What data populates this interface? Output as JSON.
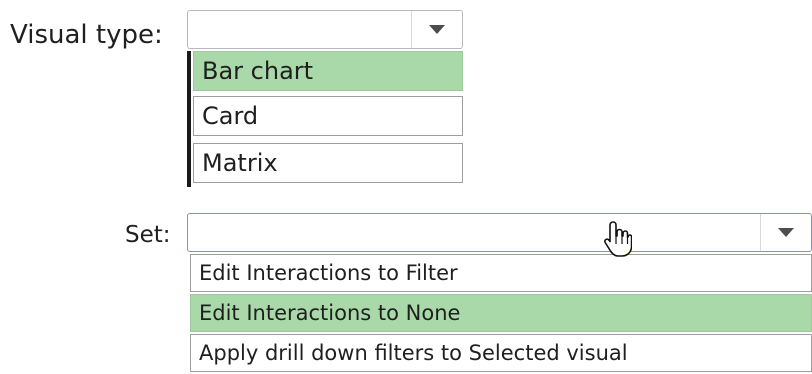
{
  "visual_type": {
    "label": "Visual type:",
    "value": "",
    "options": [
      "Bar chart",
      "Card",
      "Matrix"
    ],
    "selected": "Bar chart"
  },
  "set": {
    "label": "Set:",
    "value": "",
    "options": [
      "Edit Interactions to Filter",
      "Edit Interactions to None",
      "Apply drill down filters to Selected visual"
    ],
    "selected": "Edit Interactions to None"
  },
  "icons": {
    "dropdown_arrow": "chevron-down-icon",
    "cursor": "hand-pointer-icon"
  },
  "colors": {
    "selected_option": "#a9d8a9",
    "focus_border": "#7f95c9"
  }
}
